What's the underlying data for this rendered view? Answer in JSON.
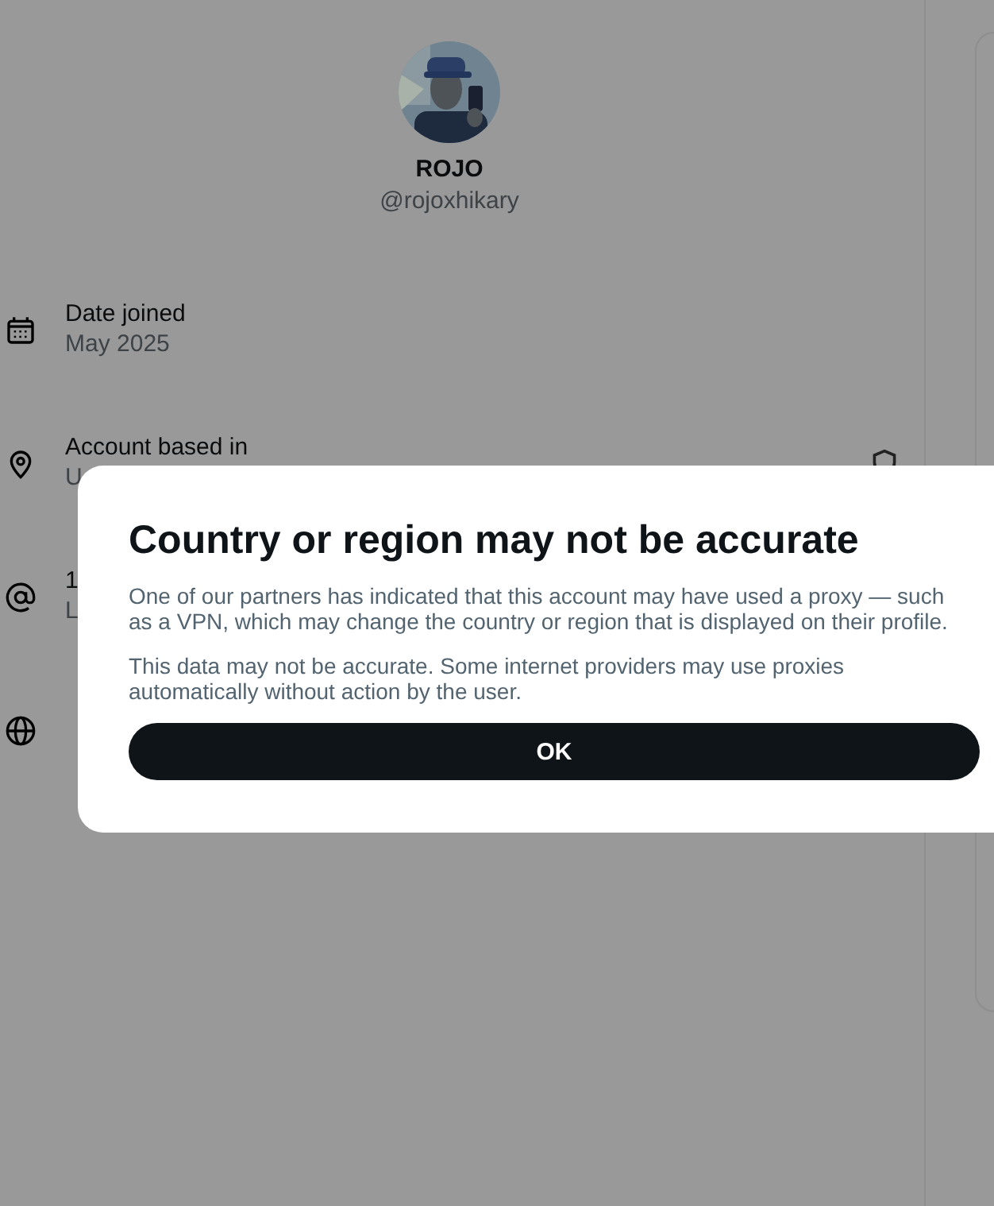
{
  "profile": {
    "name": "ROJO",
    "handle": "@rojoxhikary"
  },
  "details": [
    {
      "kind": "calendar",
      "label": "Date joined",
      "value": "May 2025",
      "shield": false
    },
    {
      "kind": "location",
      "label": "Account based in",
      "value": "U",
      "shield": true
    },
    {
      "kind": "at",
      "label": "1",
      "value": "L",
      "shield": false
    },
    {
      "kind": "globe",
      "shield": false
    }
  ],
  "dialog": {
    "title": "Country or region may not be accurate",
    "paragraphs": [
      "One of our partners has indicated that this account may have used a proxy — such as a VPN, which may change the country or region that is displayed on their profile.",
      "This data may not be accurate. Some internet providers may use proxies automatically without action by the user."
    ],
    "button": "OK"
  }
}
